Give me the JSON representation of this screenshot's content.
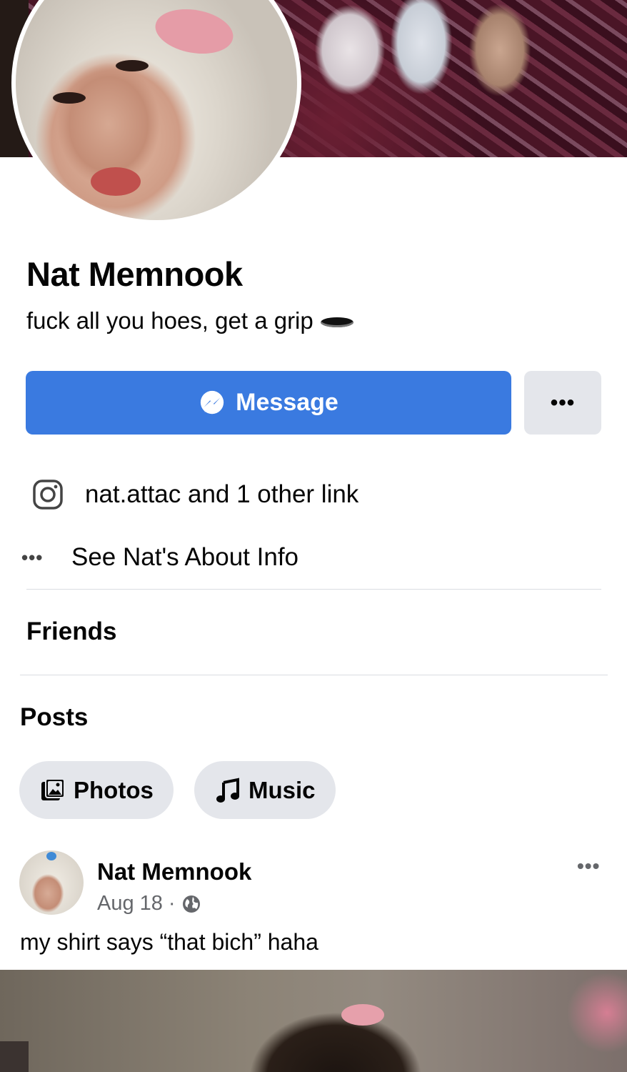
{
  "profile": {
    "name": "Nat Memnook",
    "bio": "fuck all you hoes, get a grip"
  },
  "actions": {
    "message_label": "Message",
    "more_label": "•••"
  },
  "links": {
    "instagram_text": "nat.attac and 1 other link",
    "about_dots": "•••",
    "about_text": "See Nat's About Info"
  },
  "sections": {
    "friends": "Friends",
    "posts": "Posts"
  },
  "filters": [
    {
      "label": "Photos",
      "icon": "photos-icon"
    },
    {
      "label": "Music",
      "icon": "music-icon"
    }
  ],
  "post": {
    "author": "Nat Memnook",
    "date": "Aug 18",
    "separator": "·",
    "privacy_icon": "globe-icon",
    "more_label": "•••",
    "text": "my shirt says “that bich” haha"
  },
  "colors": {
    "primary_button": "#3a7ae0",
    "secondary_button": "#e4e6eb",
    "muted_text": "#65676b"
  }
}
